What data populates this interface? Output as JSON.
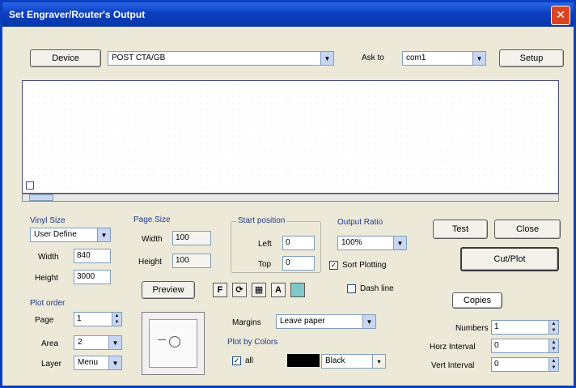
{
  "window": {
    "title": "Set Engraver/Router's Output",
    "close_symbol": "✕"
  },
  "top": {
    "device_button": "Device",
    "device_value": "POST CTA/GB",
    "ask_to_label": "Ask to",
    "ask_to_value": "com1",
    "setup_button": "Setup"
  },
  "vinyl_size": {
    "label": "Vinyl Size",
    "type_value": "User Define",
    "width_label": "Width",
    "width_value": "840",
    "height_label": "Height",
    "height_value": "3000"
  },
  "page_size": {
    "label": "Page Size",
    "width_label": "Width",
    "width_value": "100",
    "height_label": "Height",
    "height_value": "100"
  },
  "start_position": {
    "label": "Start position",
    "left_label": "Left",
    "left_value": "0",
    "top_label": "Top",
    "top_value": "0"
  },
  "output_ratio": {
    "label": "Output Ratio",
    "value": "100%",
    "sort_plotting_label": "Sort Plotting",
    "sort_plotting_checked": "✓"
  },
  "buttons": {
    "test": "Test",
    "close": "Close",
    "cut_plot": "Cut/Plot",
    "preview": "Preview"
  },
  "toolbar_icons": [
    {
      "name": "flip-icon",
      "glyph": "F"
    },
    {
      "name": "rotate-icon",
      "glyph": "⟳"
    },
    {
      "name": "fill-icon",
      "glyph": "▦"
    },
    {
      "name": "mirror-icon",
      "glyph": "A"
    },
    {
      "name": "color-icon",
      "glyph": ""
    }
  ],
  "dash_line": {
    "label": "Dash line"
  },
  "plot_order": {
    "label": "Plot order",
    "page_label": "Page",
    "page_value": "1",
    "area_label": "Area",
    "area_value": "2",
    "layer_label": "Layer",
    "layer_value": "Menu"
  },
  "margin": {
    "label": "Margins",
    "value": "Leave paper"
  },
  "plot_by_colors": {
    "label": "Plot by Colors",
    "all_label": "all",
    "all_checked": "✓",
    "color_value": "Black"
  },
  "copies": {
    "label": "Copies",
    "numbers_label": "Numbers",
    "numbers_value": "1",
    "horz_interval_label": "Horz Interval",
    "horz_interval_value": "0",
    "vert_interval_label": "Vert Interval",
    "vert_interval_value": "0"
  },
  "colors": {
    "title_bar": "#0a3fbf",
    "close": "#d94520",
    "swatch": "#000000"
  }
}
